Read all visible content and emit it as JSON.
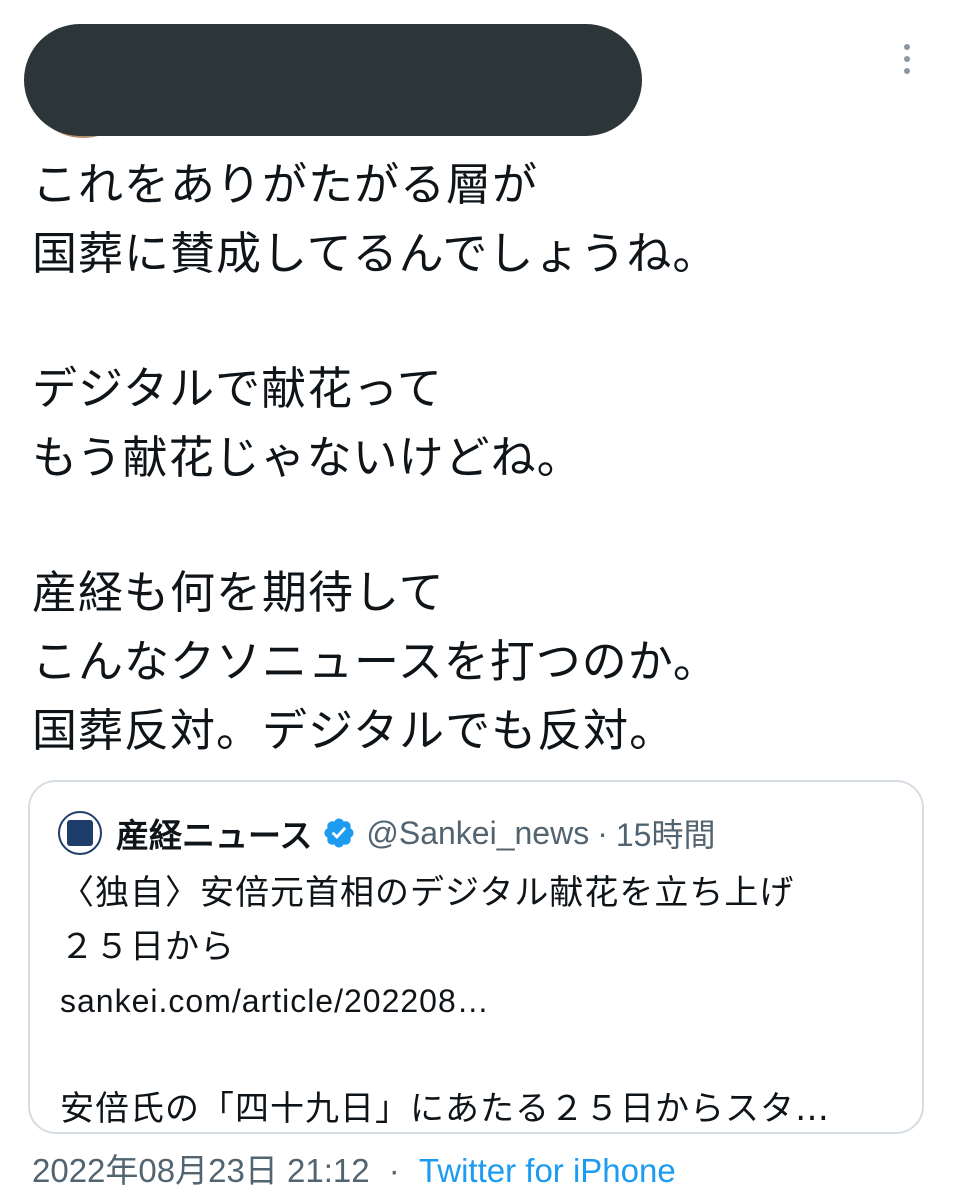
{
  "tweet": {
    "lines": [
      "これをありがたがる層が",
      "国葬に賛成してるんでしょうね。",
      "",
      "デジタルで献花って",
      "もう献花じゃないけどね。",
      "",
      "産経も何を期待して",
      "こんなクソニュースを打つのか。",
      "国葬反対。デジタルでも反対。"
    ],
    "more_icon": "more-vertical-icon"
  },
  "quote": {
    "author_name": "産経ニュース",
    "verified_icon": "verified-badge-icon",
    "handle": "@Sankei_news",
    "separator": "·",
    "time": "15時間",
    "text_lines": [
      "〈独自〉安倍元首相のデジタル献花を立ち上げ",
      "２５日から",
      "sankei.com/article/202208…",
      "",
      "安倍氏の「四十九日」にあたる２５日からスタ…"
    ]
  },
  "footer": {
    "timestamp": "2022年08月23日 21:12",
    "separator": "·",
    "source": "Twitter for iPhone"
  },
  "colors": {
    "text": "#0f1419",
    "muted": "#536471",
    "link": "#1d9bf0",
    "border": "#d5dde3",
    "redaction": "#2c3538"
  }
}
